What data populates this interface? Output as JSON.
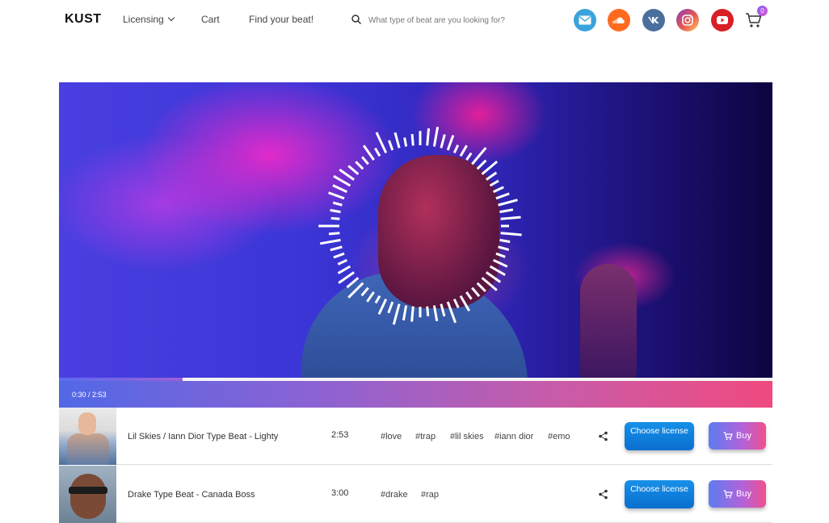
{
  "header": {
    "logo": "KUST",
    "nav": {
      "licensing": "Licensing",
      "cart": "Cart",
      "find": "Find your beat!"
    },
    "search_placeholder": "What type of beat are you looking for?",
    "social": [
      "mail-icon",
      "soundcloud-icon",
      "vk-icon",
      "instagram-icon",
      "youtube-icon"
    ],
    "cart_count": "0"
  },
  "player": {
    "time": "0:30 / 2:53",
    "progress": 0.173
  },
  "tracks": [
    {
      "title": "Lil Skies / Iann Dior Type Beat - Lighty",
      "duration": "2:53",
      "tags": [
        "#love",
        "#trap",
        "#lil skies",
        "#iann dior",
        "#emo"
      ],
      "license_label": "Choose license",
      "buy_label": "Buy"
    },
    {
      "title": "Drake Type Beat - Canada Boss",
      "duration": "3:00",
      "tags": [
        "#drake",
        "#rap"
      ],
      "license_label": "Choose license",
      "buy_label": "Buy"
    }
  ],
  "colors": {
    "accent_blue": "#0a6fd0",
    "bar_start": "#5168e6",
    "bar_end": "#f04a7f"
  }
}
